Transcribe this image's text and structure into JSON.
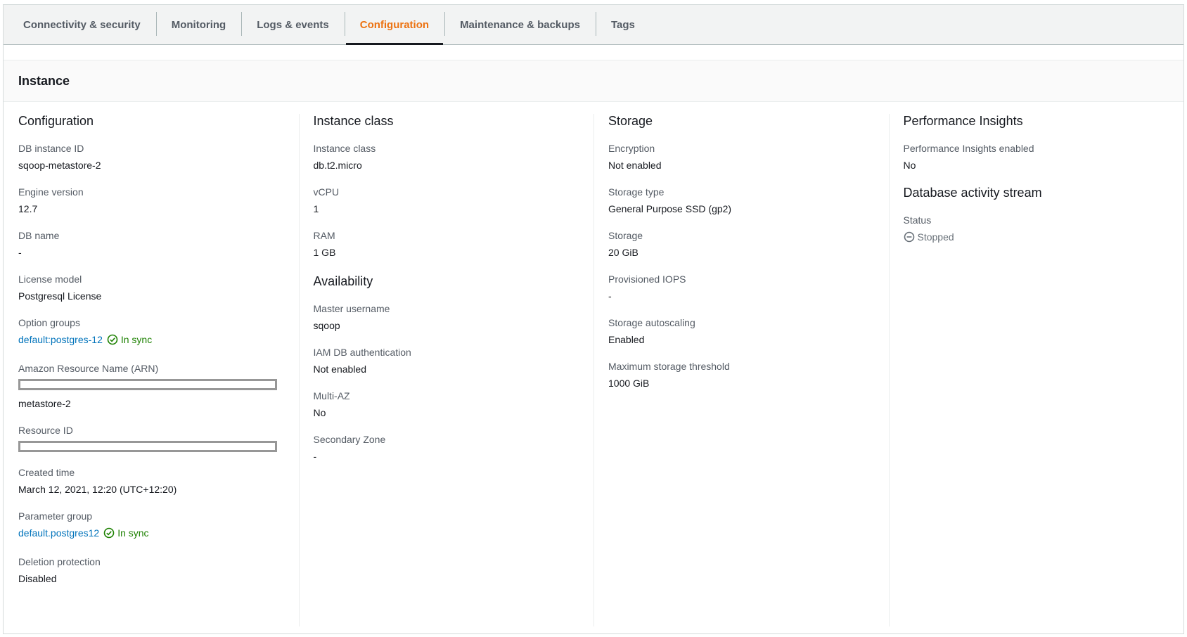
{
  "tabs": [
    {
      "label": "Connectivity & security",
      "active": false
    },
    {
      "label": "Monitoring",
      "active": false
    },
    {
      "label": "Logs & events",
      "active": false
    },
    {
      "label": "Configuration",
      "active": true
    },
    {
      "label": "Maintenance & backups",
      "active": false
    },
    {
      "label": "Tags",
      "active": false
    }
  ],
  "panel": {
    "title": "Instance"
  },
  "configuration": {
    "title": "Configuration",
    "db_instance_id": {
      "label": "DB instance ID",
      "value": "sqoop-metastore-2"
    },
    "engine_version": {
      "label": "Engine version",
      "value": "12.7"
    },
    "db_name": {
      "label": "DB name",
      "value": "-"
    },
    "license_model": {
      "label": "License model",
      "value": "Postgresql License"
    },
    "option_groups": {
      "label": "Option groups",
      "link": "default:postgres-12",
      "status": "In sync"
    },
    "arn": {
      "label": "Amazon Resource Name (ARN)",
      "value": "metastore-2"
    },
    "resource_id": {
      "label": "Resource ID"
    },
    "created_time": {
      "label": "Created time",
      "value": "March 12, 2021, 12:20 (UTC+12:20)"
    },
    "parameter_group": {
      "label": "Parameter group",
      "link": "default.postgres12",
      "status": "In sync"
    },
    "deletion_protection": {
      "label": "Deletion protection",
      "value": "Disabled"
    }
  },
  "instance_class": {
    "title": "Instance class",
    "instance_class": {
      "label": "Instance class",
      "value": "db.t2.micro"
    },
    "vcpu": {
      "label": "vCPU",
      "value": "1"
    },
    "ram": {
      "label": "RAM",
      "value": "1 GB"
    }
  },
  "availability": {
    "title": "Availability",
    "master_username": {
      "label": "Master username",
      "value": "sqoop"
    },
    "iam_auth": {
      "label": "IAM DB authentication",
      "value": "Not enabled"
    },
    "multi_az": {
      "label": "Multi-AZ",
      "value": "No"
    },
    "secondary_zone": {
      "label": "Secondary Zone",
      "value": "-"
    }
  },
  "storage": {
    "title": "Storage",
    "encryption": {
      "label": "Encryption",
      "value": "Not enabled"
    },
    "storage_type": {
      "label": "Storage type",
      "value": "General Purpose SSD (gp2)"
    },
    "storage": {
      "label": "Storage",
      "value": "20 GiB"
    },
    "provisioned_iops": {
      "label": "Provisioned IOPS",
      "value": "-"
    },
    "autoscaling": {
      "label": "Storage autoscaling",
      "value": "Enabled"
    },
    "max_threshold": {
      "label": "Maximum storage threshold",
      "value": "1000 GiB"
    }
  },
  "performance_insights": {
    "title": "Performance Insights",
    "enabled": {
      "label": "Performance Insights enabled",
      "value": "No"
    }
  },
  "activity_stream": {
    "title": "Database activity stream",
    "status": {
      "label": "Status",
      "value": "Stopped"
    }
  },
  "colors": {
    "accent": "#ec7211",
    "link": "#0073bb",
    "success": "#1d8102",
    "text": "#16191f",
    "label": "#545b64"
  },
  "icons": {
    "in_sync": "check-circle-icon",
    "stopped": "minus-circle-icon"
  }
}
